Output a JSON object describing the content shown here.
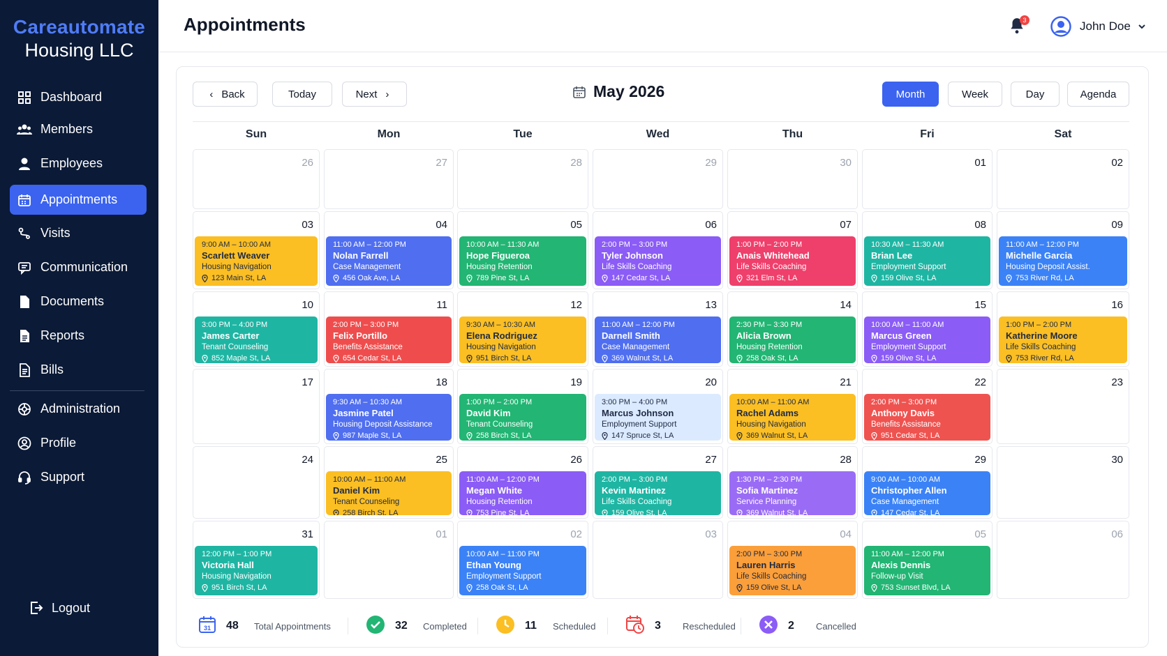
{
  "brand": {
    "line1": "Careautomate",
    "line2": "Housing LLC"
  },
  "sidebar": {
    "items": [
      {
        "label": "Dashboard",
        "icon": "grid-icon",
        "active": false
      },
      {
        "label": "Members",
        "icon": "users-icon",
        "active": false
      },
      {
        "label": "Employees",
        "icon": "user-icon",
        "active": false
      },
      {
        "label": "Appointments",
        "icon": "calendar-icon",
        "active": true
      },
      {
        "label": "Visits",
        "icon": "route-icon",
        "active": false
      },
      {
        "label": "Communication",
        "icon": "message-icon",
        "active": false
      },
      {
        "label": "Documents",
        "icon": "document-icon",
        "active": false
      },
      {
        "label": "Reports",
        "icon": "report-icon",
        "active": false
      },
      {
        "label": "Bills",
        "icon": "bill-icon",
        "active": false
      },
      {
        "label": "Administration",
        "icon": "admin-icon",
        "active": false
      },
      {
        "label": "Profile",
        "icon": "profile-icon",
        "active": false
      },
      {
        "label": "Support",
        "icon": "headset-icon",
        "active": false
      }
    ],
    "logout": "Logout"
  },
  "header": {
    "title": "Appointments",
    "notifications": "3",
    "user": "John Doe"
  },
  "toolbar": {
    "back": "Back",
    "today": "Today",
    "next": "Next",
    "month_title": "May 2026",
    "views": [
      "Month",
      "Week",
      "Day",
      "Agenda"
    ],
    "active_view": "Month"
  },
  "calendar": {
    "weekdays": [
      "Sun",
      "Mon",
      "Tue",
      "Wed",
      "Thu",
      "Fri",
      "Sat"
    ],
    "weeks": [
      [
        {
          "d": "26",
          "m": true
        },
        {
          "d": "27",
          "m": true
        },
        {
          "d": "28",
          "m": true
        },
        {
          "d": "29",
          "m": true
        },
        {
          "d": "30",
          "m": true
        },
        {
          "d": "01"
        },
        {
          "d": "02"
        }
      ],
      [
        {
          "d": "03",
          "appt": {
            "time": "9:00 AM – 10:00 AM",
            "name": "Scarlett Weaver",
            "service": "Housing Navigation",
            "address": "123 Main St, LA",
            "color": "#fbbf24",
            "light": true
          }
        },
        {
          "d": "04",
          "appt": {
            "time": "11:00 AM – 12:00 PM",
            "name": "Nolan Farrell",
            "service": "Case Management",
            "address": "456 Oak Ave, LA",
            "color": "#4f6ef0"
          }
        },
        {
          "d": "05",
          "appt": {
            "time": "10:00 AM – 11:30 AM",
            "name": "Hope Figueroa",
            "service": "Housing Retention",
            "address": "789 Pine St, LA",
            "color": "#22b573"
          }
        },
        {
          "d": "06",
          "appt": {
            "time": "2:00 PM – 3:00 PM",
            "name": "Tyler Johnson",
            "service": "Life Skills Coaching",
            "address": "147 Cedar St, LA",
            "color": "#8b5cf6"
          }
        },
        {
          "d": "07",
          "appt": {
            "time": "1:00 PM – 2:00 PM",
            "name": "Anais Whitehead",
            "service": "Life Skills Coaching",
            "address": "321 Elm St, LA",
            "color": "#ef3f6b"
          }
        },
        {
          "d": "08",
          "appt": {
            "time": "10:30 AM – 11:30 AM",
            "name": "Brian Lee",
            "service": "Employment Support",
            "address": "159 Olive St, LA",
            "color": "#1fb5a3"
          }
        },
        {
          "d": "09",
          "appt": {
            "time": "11:00 AM – 12:00 PM",
            "name": "Michelle Garcia",
            "service": "Housing Deposit Assist.",
            "address": "753 River Rd, LA",
            "color": "#3b82f6"
          }
        }
      ],
      [
        {
          "d": "10",
          "appt": {
            "time": "3:00 PM – 4:00 PM",
            "name": "James Carter",
            "service": "Tenant Counseling",
            "address": "852 Maple St, LA",
            "color": "#1fb5a3"
          }
        },
        {
          "d": "11",
          "appt": {
            "time": "2:00 PM – 3:00 PM",
            "name": "Felix Portillo",
            "service": "Benefits Assistance",
            "address": "654 Cedar St, LA",
            "color": "#ef4d4d"
          }
        },
        {
          "d": "12",
          "appt": {
            "time": "9:30 AM – 10:30 AM",
            "name": "Elena Rodriguez",
            "service": "Housing Navigation",
            "address": "951 Birch St, LA",
            "color": "#fbbf24",
            "light": true
          }
        },
        {
          "d": "13",
          "appt": {
            "time": "11:00 AM – 12:00 PM",
            "name": "Darnell Smith",
            "service": "Case Management",
            "address": "369 Walnut St, LA",
            "color": "#4f6ef0"
          }
        },
        {
          "d": "14",
          "appt": {
            "time": "2:30 PM – 3:30 PM",
            "name": "Alicia Brown",
            "service": "Housing Retention",
            "address": "258 Oak St, LA",
            "color": "#22b573"
          }
        },
        {
          "d": "15",
          "appt": {
            "time": "10:00 AM – 11:00 AM",
            "name": "Marcus Green",
            "service": "Employment Support",
            "address": "159 Olive St, LA",
            "color": "#8b5cf6"
          }
        },
        {
          "d": "16",
          "appt": {
            "time": "1:00 PM – 2:00 PM",
            "name": "Katherine Moore",
            "service": "Life Skills Coaching",
            "address": "753 River Rd, LA",
            "color": "#fbbf24",
            "light": true
          }
        }
      ],
      [
        {
          "d": "17"
        },
        {
          "d": "18",
          "appt": {
            "time": "9:30 AM – 10:30 AM",
            "name": "Jasmine Patel",
            "service": "Housing Deposit Assistance",
            "address": "987 Maple St, LA",
            "color": "#4f6ef0"
          }
        },
        {
          "d": "19",
          "appt": {
            "time": "1:00 PM – 2:00 PM",
            "name": "David Kim",
            "service": "Tenant Counseling",
            "address": "258 Birch St, LA",
            "color": "#22b573"
          }
        },
        {
          "d": "20",
          "appt": {
            "time": "3:00 PM – 4:00 PM",
            "name": "Marcus Johnson",
            "service": "Employment Support",
            "address": "147 Spruce St, LA",
            "color": "#dbeafe",
            "light": true
          }
        },
        {
          "d": "21",
          "appt": {
            "time": "10:00 AM – 11:00 AM",
            "name": "Rachel Adams",
            "service": "Housing Navigation",
            "address": "369 Walnut St, LA",
            "color": "#fbbf24",
            "light": true
          }
        },
        {
          "d": "22",
          "appt": {
            "time": "2:00 PM – 3:00 PM",
            "name": "Anthony Davis",
            "service": "Benefits Assistance",
            "address": "951 Cedar St, LA",
            "color": "#ef5350"
          }
        },
        {
          "d": "23"
        }
      ],
      [
        {
          "d": "24"
        },
        {
          "d": "25",
          "appt": {
            "time": "10:00 AM – 11:00 AM",
            "name": "Daniel Kim",
            "service": "Tenant Counseling",
            "address": "258 Birch St, LA",
            "color": "#fbbf24",
            "light": true
          }
        },
        {
          "d": "26",
          "appt": {
            "time": "11:00 AM – 12:00 PM",
            "name": "Megan White",
            "service": "Housing Retention",
            "address": "753 Pine St, LA",
            "color": "#8b5cf6"
          }
        },
        {
          "d": "27",
          "appt": {
            "time": "2:00 PM – 3:00 PM",
            "name": "Kevin Martinez",
            "service": "Life Skills Coaching",
            "address": "159 Olive St, LA",
            "color": "#1fb5a3"
          }
        },
        {
          "d": "28",
          "appt": {
            "time": "1:30 PM – 2:30 PM",
            "name": "Sofia Martinez",
            "service": "Service Planning",
            "address": "369 Walnut St, LA",
            "color": "#9a6cf5"
          }
        },
        {
          "d": "29",
          "appt": {
            "time": "9:00 AM – 10:00 AM",
            "name": "Christopher Allen",
            "service": "Case Management",
            "address": "147 Cedar St, LA",
            "color": "#3b82f6"
          }
        },
        {
          "d": "30"
        }
      ],
      [
        {
          "d": "31",
          "appt": {
            "time": "12:00 PM – 1:00 PM",
            "name": "Victoria Hall",
            "service": "Housing Navigation",
            "address": "951 Birch St, LA",
            "color": "#1fb5a3"
          }
        },
        {
          "d": "01",
          "m": true
        },
        {
          "d": "02",
          "m": true,
          "appt": {
            "time": "10:00 AM – 11:00 PM",
            "name": "Ethan Young",
            "service": "Employment Support",
            "address": "258 Oak St, LA",
            "color": "#3b82f6"
          }
        },
        {
          "d": "03",
          "m": true
        },
        {
          "d": "04",
          "m": true,
          "appt": {
            "time": "2:00 PM – 3:00 PM",
            "name": "Lauren Harris",
            "service": "Life Skills Coaching",
            "address": "159 Olive St, LA",
            "color": "#fb9f3a",
            "light": true
          }
        },
        {
          "d": "05",
          "m": true,
          "appt": {
            "time": "11:00 AM – 12:00 PM",
            "name": "Alexis Dennis",
            "service": "Follow-up Visit",
            "address": "753 Sunset Blvd, LA",
            "color": "#22b573"
          }
        },
        {
          "d": "06",
          "m": true
        }
      ]
    ]
  },
  "stats": [
    {
      "num": "48",
      "label": "Total Appointments",
      "icon": "calendar-icon",
      "color": "#3b63f0"
    },
    {
      "num": "32",
      "label": "Completed",
      "icon": "check-circle-icon",
      "color": "#22b573"
    },
    {
      "num": "11",
      "label": "Scheduled",
      "icon": "clock-icon",
      "color": "#fbbf24"
    },
    {
      "num": "3",
      "label": "Rescheduled",
      "icon": "calendar-clock-icon",
      "color": "#ef4444"
    },
    {
      "num": "2",
      "label": "Cancelled",
      "icon": "x-circle-icon",
      "color": "#8b5cf6"
    }
  ]
}
